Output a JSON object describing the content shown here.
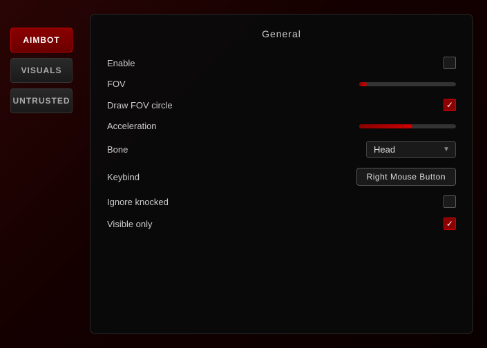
{
  "sidebar": {
    "items": [
      {
        "label": "AIMBOT",
        "active": true
      },
      {
        "label": "VISUALS",
        "active": false
      },
      {
        "label": "UNTRUSTED",
        "active": false
      }
    ]
  },
  "panel": {
    "title": "General",
    "rows": [
      {
        "label": "Enable",
        "control_type": "checkbox",
        "checked": false
      },
      {
        "label": "FOV",
        "control_type": "slider",
        "fill_percent": 8
      },
      {
        "label": "Draw FOV circle",
        "control_type": "checkbox",
        "checked": true
      },
      {
        "label": "Acceleration",
        "control_type": "slider",
        "fill_percent": 55
      },
      {
        "label": "Bone",
        "control_type": "dropdown",
        "value": "Head"
      },
      {
        "label": "Keybind",
        "control_type": "keybind",
        "value": "Right Mouse Button"
      },
      {
        "label": "Ignore knocked",
        "control_type": "checkbox",
        "checked": false
      },
      {
        "label": "Visible only",
        "control_type": "checkbox",
        "checked": true
      }
    ]
  }
}
